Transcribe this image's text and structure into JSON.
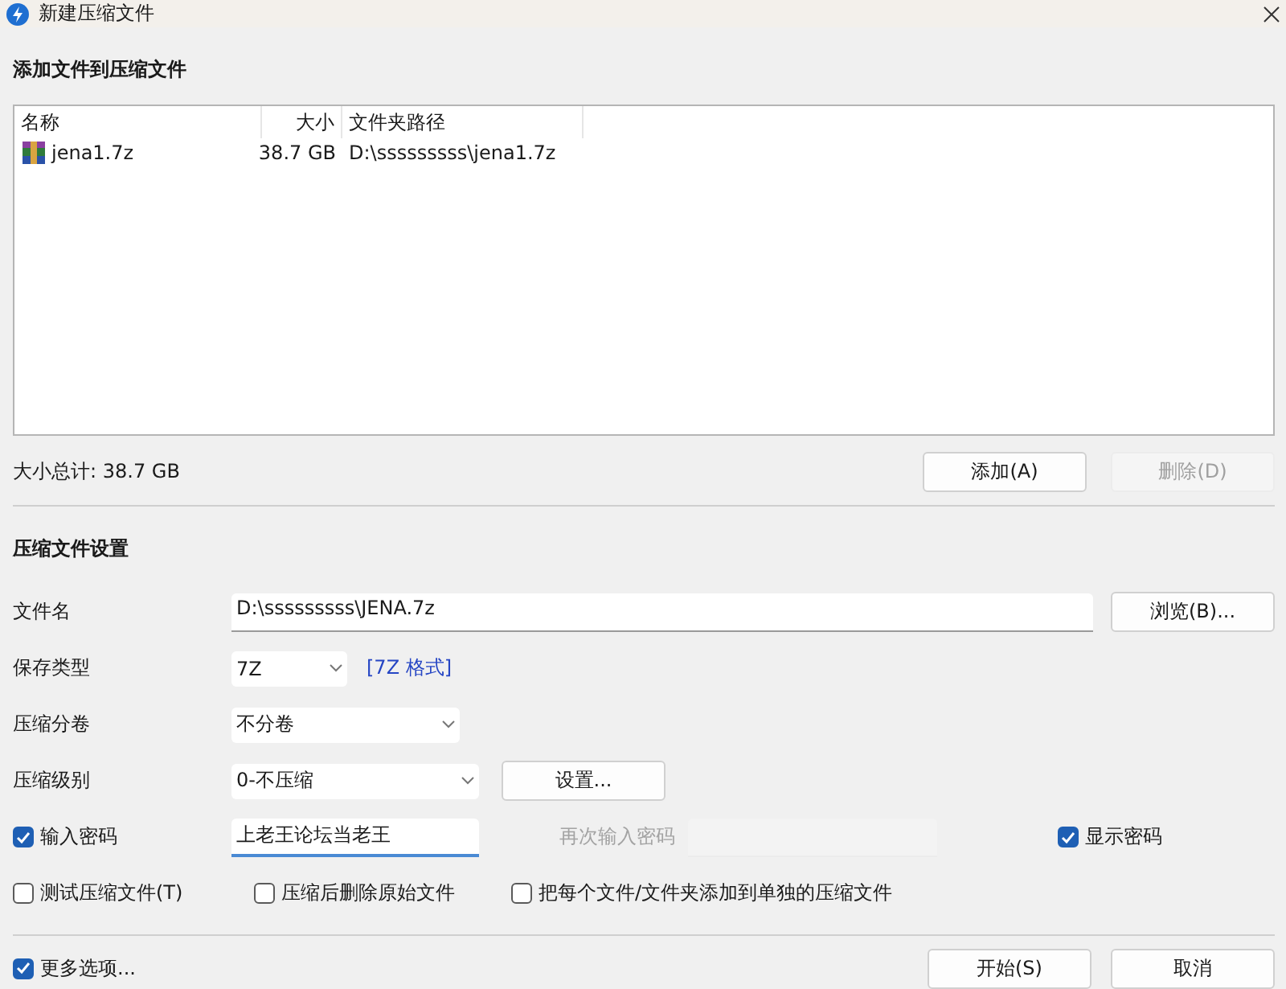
{
  "window": {
    "title": "新建压缩文件"
  },
  "files": {
    "title": "添加文件到压缩文件",
    "columns": [
      "名称",
      "大小",
      "文件夹路径"
    ],
    "rows": [
      {
        "name": "jena1.7z",
        "size": "38.7 GB",
        "path": "D:\\sssssssss\\jena1.7z"
      }
    ],
    "total": "大小总计: 38.7 GB",
    "buttons": [
      {
        "label": "添加(A)",
        "disabled": false
      },
      {
        "label": "删除(D)",
        "disabled": true
      }
    ]
  },
  "settings": {
    "title": "压缩文件设置",
    "filename": {
      "label": "文件名",
      "value": "D:\\sssssssss\\JENA.7z",
      "button": "浏览(B)..."
    },
    "format": {
      "label": "保存类型",
      "value": "7Z",
      "link": "[7Z 格式]"
    },
    "volume": {
      "label": "压缩分卷",
      "value": "不分卷"
    },
    "level": {
      "label": "压缩级别",
      "value": "0-不压缩",
      "button": "设置..."
    },
    "password": {
      "label": "输入密码",
      "checked": true,
      "value": "上老王论坛当老王",
      "confirm_label": "再次输入密码",
      "confirm_disabled": true,
      "show_label": "显示密码",
      "show_checked": true
    },
    "options": [
      {
        "label": "测试压缩文件(T)",
        "checked": false
      },
      {
        "label": "压缩后删除原始文件",
        "checked": false
      },
      {
        "label": "把每个文件/文件夹添加到单独的压缩文件",
        "checked": false
      }
    ]
  },
  "footer": {
    "more": {
      "label": "更多选项...",
      "checked": true
    },
    "buttons": [
      {
        "label": "开始(S)",
        "disabled": false
      },
      {
        "label": "取消",
        "disabled": false
      }
    ]
  }
}
